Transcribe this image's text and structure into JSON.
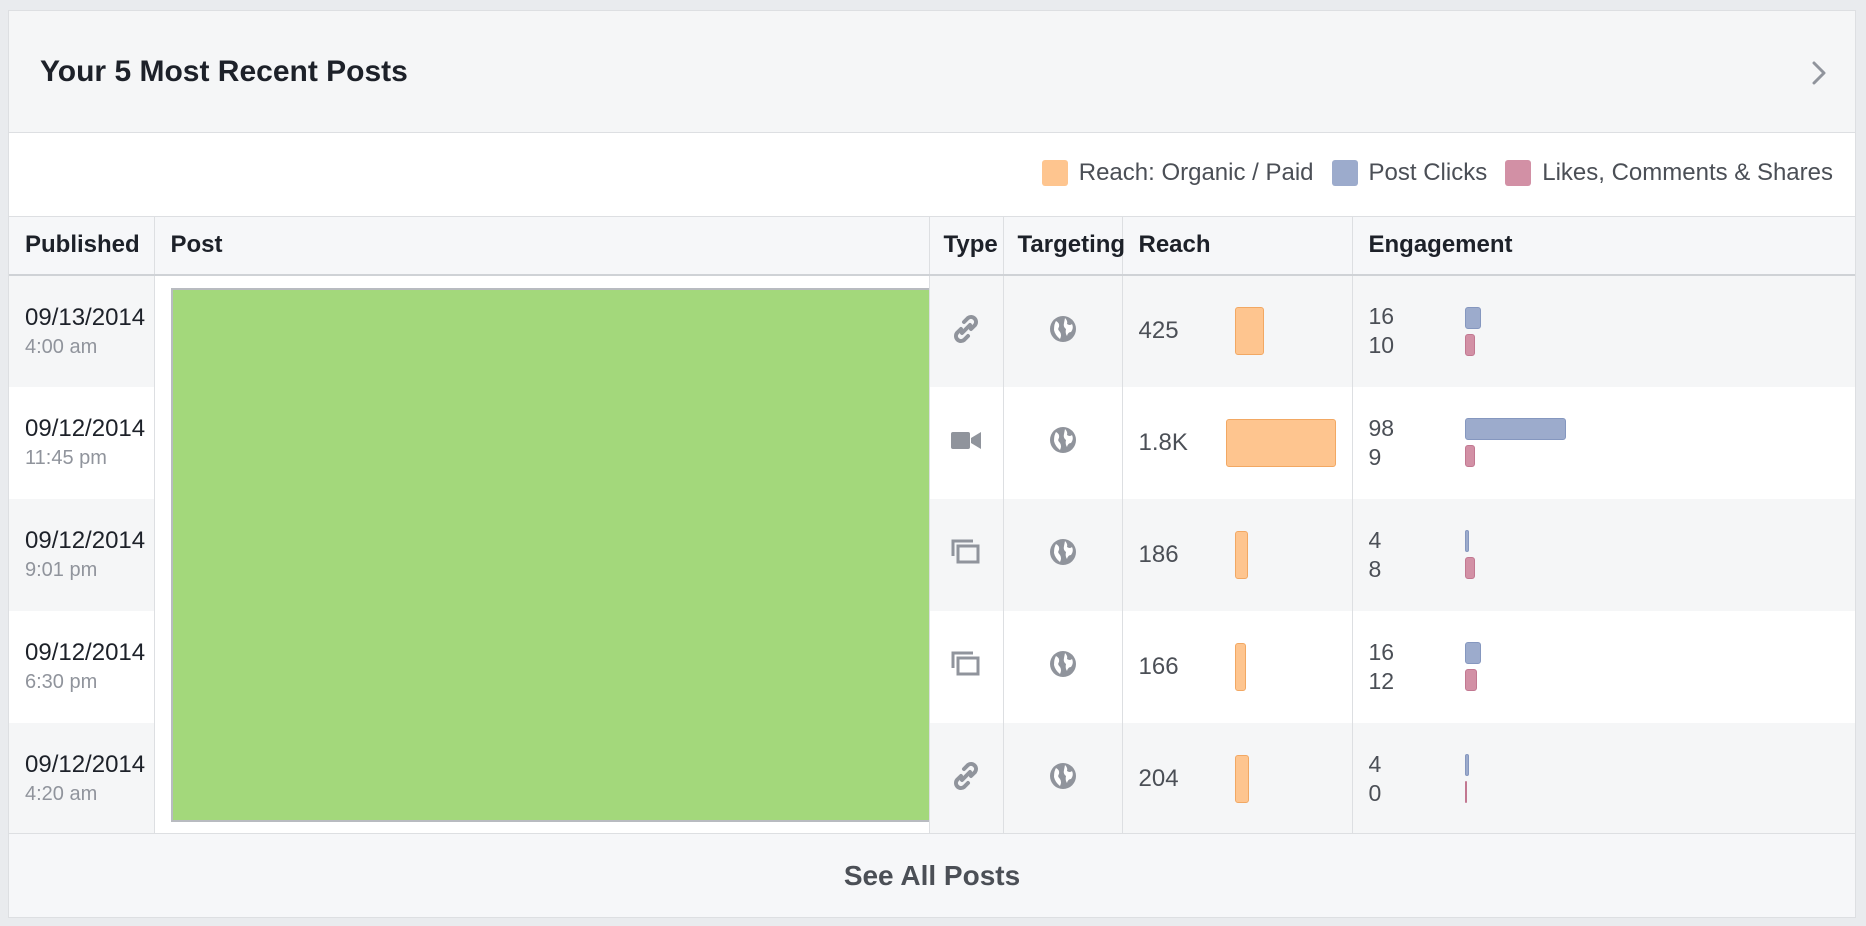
{
  "header": {
    "title": "Your 5 Most Recent Posts"
  },
  "colors": {
    "reach": "#fec58f",
    "post_clicks": "#9cabcc",
    "engagement": "#d290a5",
    "post_thumbnail": "#a3d87b"
  },
  "legend": [
    {
      "label": "Reach: Organic / Paid",
      "color": "#fec58f"
    },
    {
      "label": "Post Clicks",
      "color": "#9cabcc"
    },
    {
      "label": "Likes, Comments & Shares",
      "color": "#d290a5"
    }
  ],
  "columns": [
    "Published",
    "Post",
    "Type",
    "Targeting",
    "Reach",
    "Engagement"
  ],
  "rows": [
    {
      "date": "09/13/2014",
      "time": "4:00 am",
      "type_icon": "link-icon",
      "targeting_icon": "globe-icon",
      "reach": "425",
      "post_clicks": "16",
      "likes_comments_shares": "10"
    },
    {
      "date": "09/12/2014",
      "time": "11:45 pm",
      "type_icon": "video-icon",
      "targeting_icon": "globe-icon",
      "reach": "1.8K",
      "post_clicks": "98",
      "likes_comments_shares": "9"
    },
    {
      "date": "09/12/2014",
      "time": "9:01 pm",
      "type_icon": "photo-album-icon",
      "targeting_icon": "globe-icon",
      "reach": "186",
      "post_clicks": "4",
      "likes_comments_shares": "8"
    },
    {
      "date": "09/12/2014",
      "time": "6:30 pm",
      "type_icon": "photo-album-icon",
      "targeting_icon": "globe-icon",
      "reach": "166",
      "post_clicks": "16",
      "likes_comments_shares": "12"
    },
    {
      "date": "09/12/2014",
      "time": "4:20 am",
      "type_icon": "link-icon",
      "targeting_icon": "globe-icon",
      "reach": "204",
      "post_clicks": "4",
      "likes_comments_shares": "0"
    }
  ],
  "footer": {
    "label": "See All Posts"
  }
}
